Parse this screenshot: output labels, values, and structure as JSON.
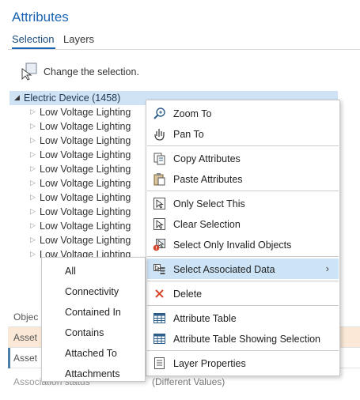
{
  "pane": {
    "title": "Attributes",
    "tabs": [
      {
        "label": "Selection",
        "active": true
      },
      {
        "label": "Layers",
        "active": false
      }
    ],
    "hint": "Change the selection."
  },
  "tree": {
    "root_label": "Electric Device (1458)",
    "children": [
      "Low Voltage Lighting",
      "Low Voltage Lighting",
      "Low Voltage Lighting",
      "Low Voltage Lighting",
      "Low Voltage Lighting",
      "Low Voltage Lighting",
      "Low Voltage Lighting",
      "Low Voltage Lighting",
      "Low Voltage Lighting",
      "Low Voltage Lighting",
      "Low Voltage Lighting"
    ]
  },
  "grid": {
    "rows": [
      {
        "left": "Objec",
        "right": ""
      },
      {
        "left": "Asset",
        "right": ""
      },
      {
        "left": "Asset",
        "right": ""
      },
      {
        "left": "Association status",
        "right": "(Different Values)"
      }
    ]
  },
  "context_menu": {
    "items": [
      {
        "label": "Zoom To",
        "icon": "zoom-to-icon"
      },
      {
        "label": "Pan To",
        "icon": "pan-to-icon"
      },
      {
        "label": "Copy Attributes",
        "icon": "copy-attributes-icon"
      },
      {
        "label": "Paste Attributes",
        "icon": "paste-attributes-icon"
      },
      {
        "label": "Only Select This",
        "icon": "only-select-this-icon"
      },
      {
        "label": "Clear Selection",
        "icon": "clear-selection-icon"
      },
      {
        "label": "Select Only Invalid Objects",
        "icon": "select-invalid-icon"
      },
      {
        "label": "Select Associated Data",
        "icon": "select-associated-icon",
        "submenu_arrow": "›"
      },
      {
        "label": "Delete",
        "icon": "delete-icon"
      },
      {
        "label": "Attribute Table",
        "icon": "attribute-table-icon"
      },
      {
        "label": "Attribute Table Showing Selection",
        "icon": "attribute-table-selection-icon"
      },
      {
        "label": "Layer Properties",
        "icon": "layer-properties-icon"
      }
    ]
  },
  "submenu": {
    "items": [
      "All",
      "Connectivity",
      "Contained In",
      "Contains",
      "Attached To",
      "Attachments"
    ]
  },
  "colors": {
    "accent": "#1a64b3",
    "selection_highlight": "#cde4f7",
    "tree_selected": "#cfe3f5",
    "row_highlight": "#fbe8d6",
    "delete_red": "#d9452b"
  }
}
